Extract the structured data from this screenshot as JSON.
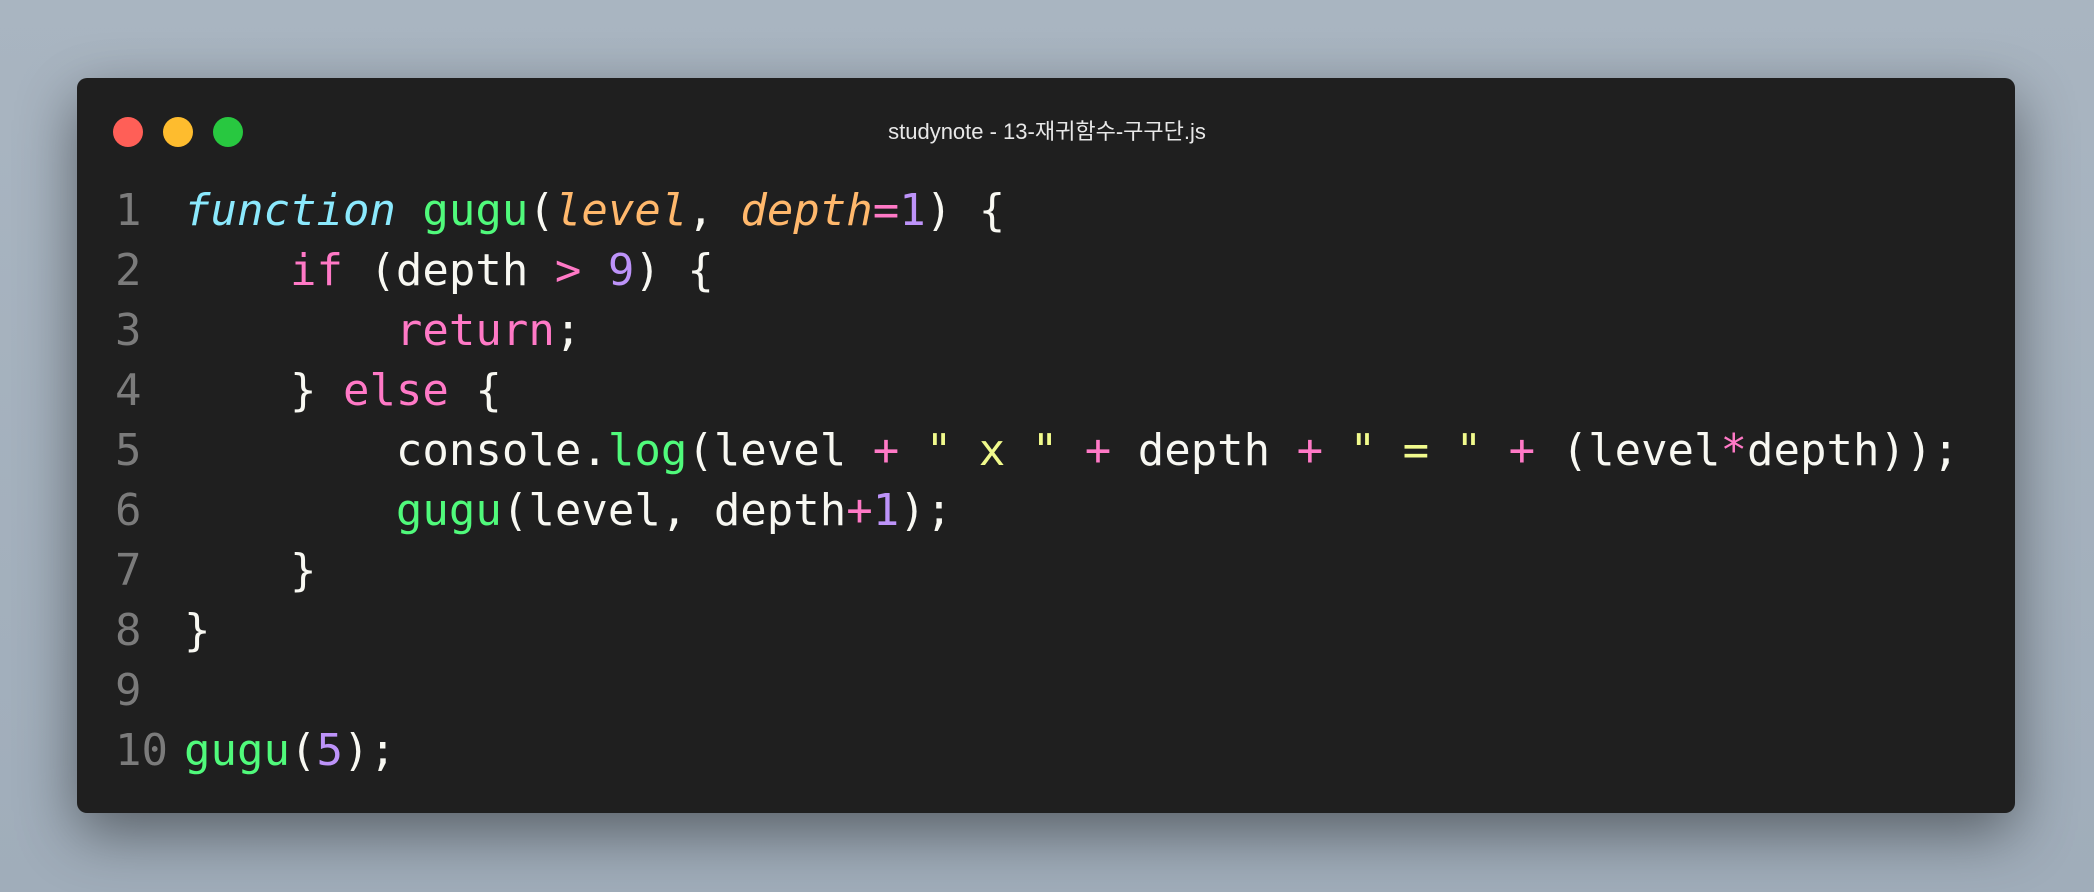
{
  "window": {
    "title": "studynote - 13-재귀함수-구구단.js",
    "controls": {
      "close_color": "#ff5f57",
      "minimize_color": "#febc2e",
      "maximize_color": "#28c840"
    }
  },
  "code": {
    "language": "javascript",
    "lines": [
      {
        "number": "1",
        "tokens": [
          [
            "kw",
            "function"
          ],
          [
            "plain",
            " "
          ],
          [
            "fn",
            "gugu"
          ],
          [
            "plain",
            "("
          ],
          [
            "param",
            "level"
          ],
          [
            "plain",
            ", "
          ],
          [
            "param",
            "depth"
          ],
          [
            "op",
            "="
          ],
          [
            "num",
            "1"
          ],
          [
            "plain",
            ") {"
          ]
        ]
      },
      {
        "number": "2",
        "tokens": [
          [
            "plain",
            "    "
          ],
          [
            "ctrl",
            "if"
          ],
          [
            "plain",
            " (depth "
          ],
          [
            "op",
            ">"
          ],
          [
            "plain",
            " "
          ],
          [
            "num",
            "9"
          ],
          [
            "plain",
            ") {"
          ]
        ]
      },
      {
        "number": "3",
        "tokens": [
          [
            "plain",
            "        "
          ],
          [
            "ctrl",
            "return"
          ],
          [
            "plain",
            ";"
          ]
        ]
      },
      {
        "number": "4",
        "tokens": [
          [
            "plain",
            "    } "
          ],
          [
            "ctrl",
            "else"
          ],
          [
            "plain",
            " {"
          ]
        ]
      },
      {
        "number": "5",
        "tokens": [
          [
            "plain",
            "        console."
          ],
          [
            "fn",
            "log"
          ],
          [
            "plain",
            "(level "
          ],
          [
            "op",
            "+"
          ],
          [
            "plain",
            " "
          ],
          [
            "str",
            "\" x \""
          ],
          [
            "plain",
            " "
          ],
          [
            "op",
            "+"
          ],
          [
            "plain",
            " depth "
          ],
          [
            "op",
            "+"
          ],
          [
            "plain",
            " "
          ],
          [
            "str",
            "\" = \""
          ],
          [
            "plain",
            " "
          ],
          [
            "op",
            "+"
          ],
          [
            "plain",
            " (level"
          ],
          [
            "op",
            "*"
          ],
          [
            "plain",
            "depth));"
          ]
        ]
      },
      {
        "number": "6",
        "tokens": [
          [
            "plain",
            "        "
          ],
          [
            "fn",
            "gugu"
          ],
          [
            "plain",
            "(level, depth"
          ],
          [
            "op",
            "+"
          ],
          [
            "num",
            "1"
          ],
          [
            "plain",
            ");"
          ]
        ]
      },
      {
        "number": "7",
        "tokens": [
          [
            "plain",
            "    }"
          ]
        ]
      },
      {
        "number": "8",
        "tokens": [
          [
            "plain",
            "}"
          ]
        ]
      },
      {
        "number": "9",
        "tokens": []
      },
      {
        "number": "10",
        "tokens": [
          [
            "fn",
            "gugu"
          ],
          [
            "plain",
            "("
          ],
          [
            "num",
            "5"
          ],
          [
            "plain",
            ");"
          ]
        ]
      }
    ]
  }
}
